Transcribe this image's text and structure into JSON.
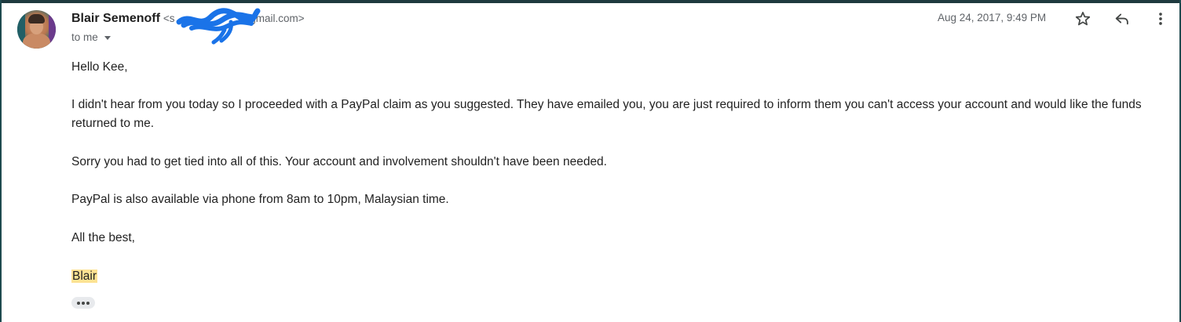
{
  "sender": {
    "name": "Blair Semenoff",
    "email_prefix": "<s",
    "email_suffix": "@gmail.com>"
  },
  "recipient": {
    "label": "to me"
  },
  "meta": {
    "date": "Aug 24, 2017, 9:49 PM"
  },
  "actions": {
    "star_icon": "star-icon",
    "reply_icon": "reply-icon",
    "more_icon": "more-vert-icon"
  },
  "message": {
    "greeting": "Hello Kee,",
    "paragraph_1": "I didn't hear from you today so I proceeded with a PayPal claim as you suggested. They have emailed you, you are just required to inform them you can't access your account and would like the funds returned to me.",
    "paragraph_2": "Sorry you had to get tied into all of this. Your account and involvement shouldn't have been needed.",
    "paragraph_3": "PayPal is also available via phone from 8am to 10pm, Malaysian time.",
    "closing": "All the best,",
    "signature": "Blair"
  },
  "colors": {
    "accent_border": "#1e4a4f",
    "highlight": "#fde293",
    "redaction": "#1a73e8"
  }
}
